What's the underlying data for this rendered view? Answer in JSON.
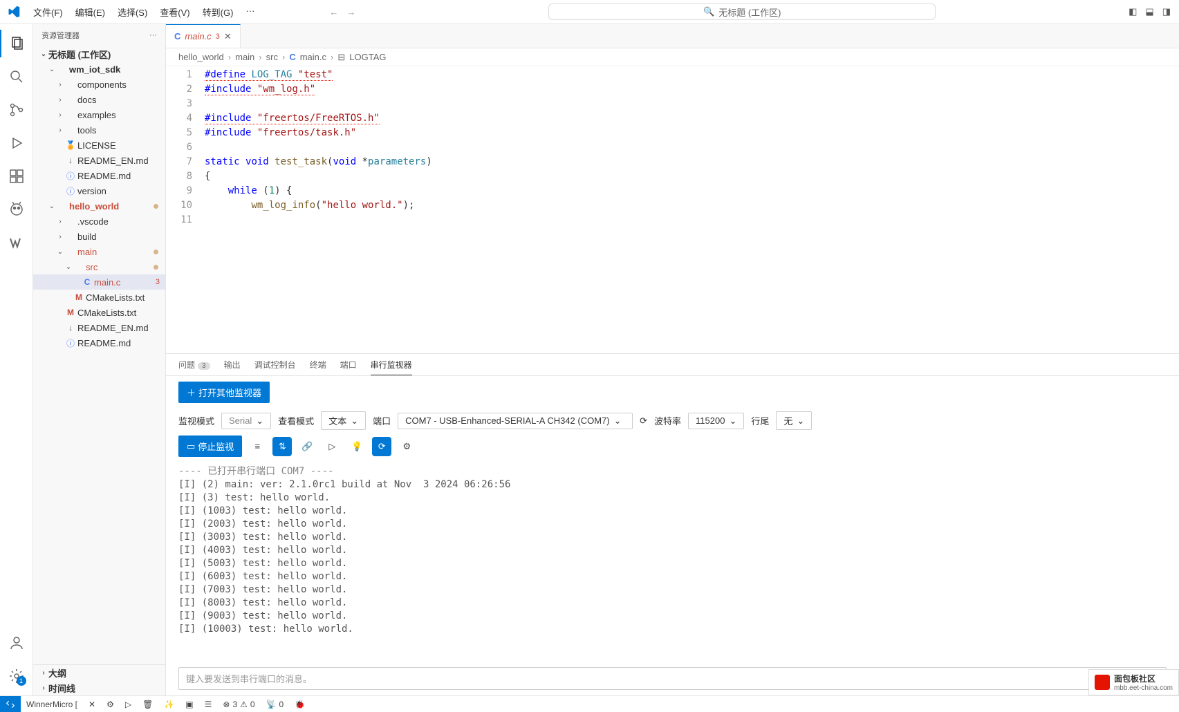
{
  "titlebar": {
    "menus": [
      "文件(F)",
      "编辑(E)",
      "选择(S)",
      "查看(V)",
      "转到(G)",
      "···"
    ],
    "search_label": "无标题 (工作区)"
  },
  "activitybar": {
    "badge": "1"
  },
  "sidebar": {
    "title": "资源管理器",
    "root": "无标题 (工作区)",
    "tree": [
      {
        "lvl": 1,
        "chev": "down",
        "icon": "",
        "label": "wm_iot_sdk",
        "cls": "bold"
      },
      {
        "lvl": 2,
        "chev": "right",
        "icon": "",
        "label": "components"
      },
      {
        "lvl": 2,
        "chev": "right",
        "icon": "",
        "label": "docs"
      },
      {
        "lvl": 2,
        "chev": "right",
        "icon": "",
        "label": "examples"
      },
      {
        "lvl": 2,
        "chev": "right",
        "icon": "",
        "label": "tools"
      },
      {
        "lvl": 2,
        "chev": "",
        "icon": "cert",
        "label": "LICENSE"
      },
      {
        "lvl": 2,
        "chev": "",
        "icon": "yml",
        "label": "README_EN.md"
      },
      {
        "lvl": 2,
        "chev": "",
        "icon": "info",
        "label": "README.md"
      },
      {
        "lvl": 2,
        "chev": "",
        "icon": "info",
        "label": "version"
      },
      {
        "lvl": 1,
        "chev": "down",
        "icon": "",
        "label": "hello_world",
        "cls": "red bold",
        "dot": true
      },
      {
        "lvl": 2,
        "chev": "right",
        "icon": "",
        "label": ".vscode"
      },
      {
        "lvl": 2,
        "chev": "right",
        "icon": "",
        "label": "build"
      },
      {
        "lvl": 2,
        "chev": "down",
        "icon": "",
        "label": "main",
        "cls": "red",
        "dot": true
      },
      {
        "lvl": 3,
        "chev": "down",
        "icon": "",
        "label": "src",
        "cls": "red",
        "dot": true
      },
      {
        "lvl": 4,
        "chev": "",
        "icon": "c",
        "label": "main.c",
        "cls": "red",
        "sel": true,
        "badge": "3"
      },
      {
        "lvl": 3,
        "chev": "",
        "icon": "m",
        "label": "CMakeLists.txt"
      },
      {
        "lvl": 2,
        "chev": "",
        "icon": "m",
        "label": "CMakeLists.txt"
      },
      {
        "lvl": 2,
        "chev": "",
        "icon": "yml",
        "label": "README_EN.md"
      },
      {
        "lvl": 2,
        "chev": "",
        "icon": "info",
        "label": "README.md"
      }
    ],
    "footer": [
      {
        "chev": "right",
        "label": "大纲"
      },
      {
        "chev": "right",
        "label": "时间线"
      }
    ]
  },
  "tab": {
    "icon": "C",
    "label": "main.c",
    "badge": "3"
  },
  "breadcrumbs": [
    "hello_world",
    "main",
    "src",
    "main.c",
    "LOGTAG"
  ],
  "breadcrumb_last_icon": "⊟",
  "code": {
    "lines": [
      "1",
      "2",
      "3",
      "4",
      "5",
      "6",
      "7",
      "8",
      "9",
      "10",
      "11"
    ]
  },
  "panel": {
    "tabs": [
      {
        "label": "问题",
        "count": "3"
      },
      {
        "label": "输出"
      },
      {
        "label": "调试控制台"
      },
      {
        "label": "终端"
      },
      {
        "label": "端口"
      },
      {
        "label": "串行监视器",
        "active": true
      }
    ],
    "open_other": "打开其他监视器",
    "row2": {
      "mode_label": "监视模式",
      "mode_value": "Serial",
      "view_label": "查看模式",
      "view_value": "文本",
      "port_label": "端口",
      "port_value": "COM7 - USB-Enhanced-SERIAL-A CH342 (COM7)",
      "baud_label": "波特率",
      "baud_value": "115200",
      "eol_label": "行尾",
      "eol_value": "无"
    },
    "stop_btn": "停止监视",
    "terminal_header": "---- 已打开串行端口 COM7 ----",
    "terminal_lines": [
      "[I] (2) main: ver: 2.1.0rc1 build at Nov  3 2024 06:26:56",
      "[I] (3) test: hello world.",
      "[I] (1003) test: hello world.",
      "[I] (2003) test: hello world.",
      "[I] (3003) test: hello world.",
      "[I] (4003) test: hello world.",
      "[I] (5003) test: hello world.",
      "[I] (6003) test: hello world.",
      "[I] (7003) test: hello world.",
      "[I] (8003) test: hello world.",
      "[I] (9003) test: hello world.",
      "[I] (10003) test: hello world."
    ],
    "send_placeholder": "键入要发送到串行端口的消息。"
  },
  "statusbar": {
    "project": "WinnerMicro [",
    "errors": "3",
    "warnings": "0",
    "radio": "0"
  },
  "watermark": {
    "title": "面包板社区",
    "sub": "mbb.eet-china.com"
  }
}
